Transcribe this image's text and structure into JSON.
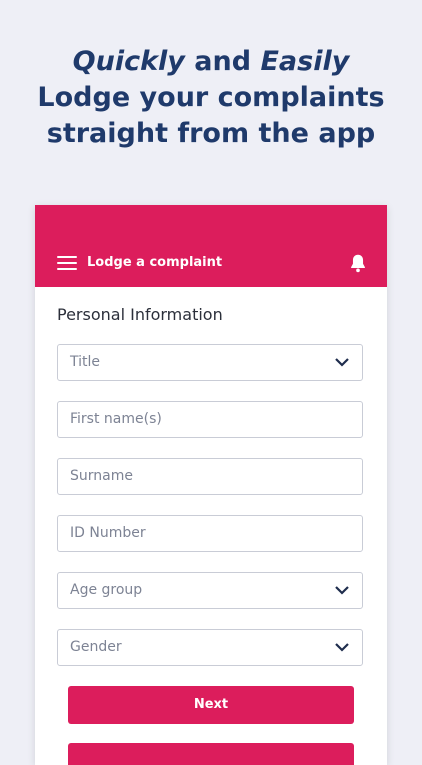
{
  "headline": {
    "line1_italic_a": "Quickly",
    "line1_and": " and ",
    "line1_italic_b": "Easily",
    "line2": "Lodge your complaints",
    "line3": "straight from the app"
  },
  "appbar": {
    "title": "Lodge a complaint",
    "menu_icon": "hamburger-menu-icon",
    "notification_icon": "bell-icon",
    "color": "#dc1d5c"
  },
  "form": {
    "section_title": "Personal Information",
    "fields": {
      "title": "Title",
      "first_name": "First name(s)",
      "surname": "Surname",
      "id_number": "ID Number",
      "age_group": "Age group",
      "gender": "Gender"
    },
    "next_label": "Next"
  }
}
